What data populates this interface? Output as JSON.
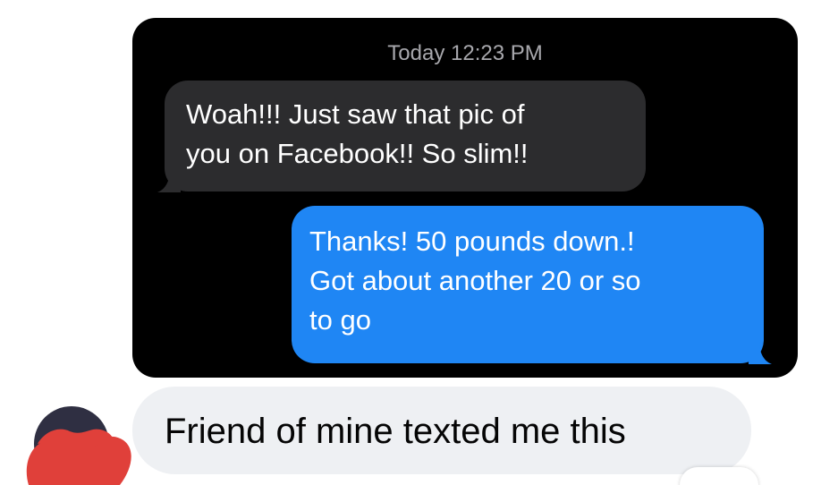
{
  "conversation": {
    "timestamp": "Today 12:23 PM",
    "incoming": {
      "lines": [
        "Woah!!! Just saw that pic of",
        "you on Facebook!! So slim!!"
      ]
    },
    "outgoing": {
      "lines": [
        "Thanks! 50 pounds down.!",
        "Got about another 20 or so",
        "to go"
      ]
    }
  },
  "comment": {
    "text": "Friend of mine texted me this"
  },
  "colors": {
    "incoming_bubble": "#2c2c2e",
    "outgoing_bubble": "#1f86f4",
    "comment_bubble": "#eef0f3",
    "avatar_cover": "#e0403a"
  }
}
